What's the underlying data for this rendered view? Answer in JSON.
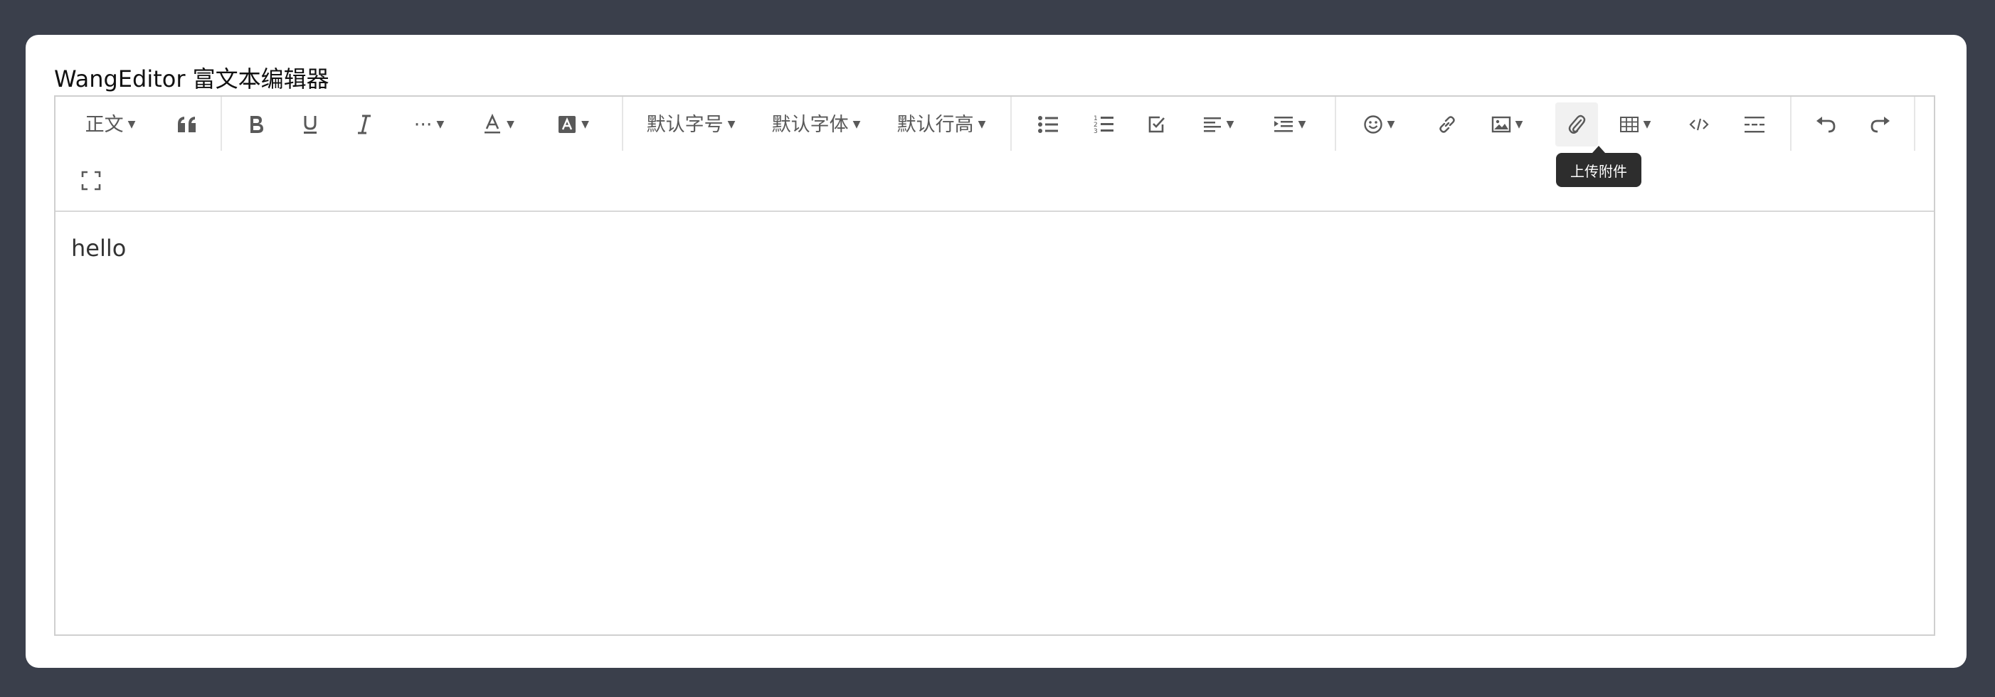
{
  "page": {
    "title": "WangEditor 富文本编辑器"
  },
  "toolbar": {
    "heading": "正文",
    "font_size": "默认字号",
    "font_family": "默认字体",
    "line_height": "默认行高",
    "more": "···",
    "tooltip": "上传附件"
  },
  "editor": {
    "content": "hello"
  }
}
